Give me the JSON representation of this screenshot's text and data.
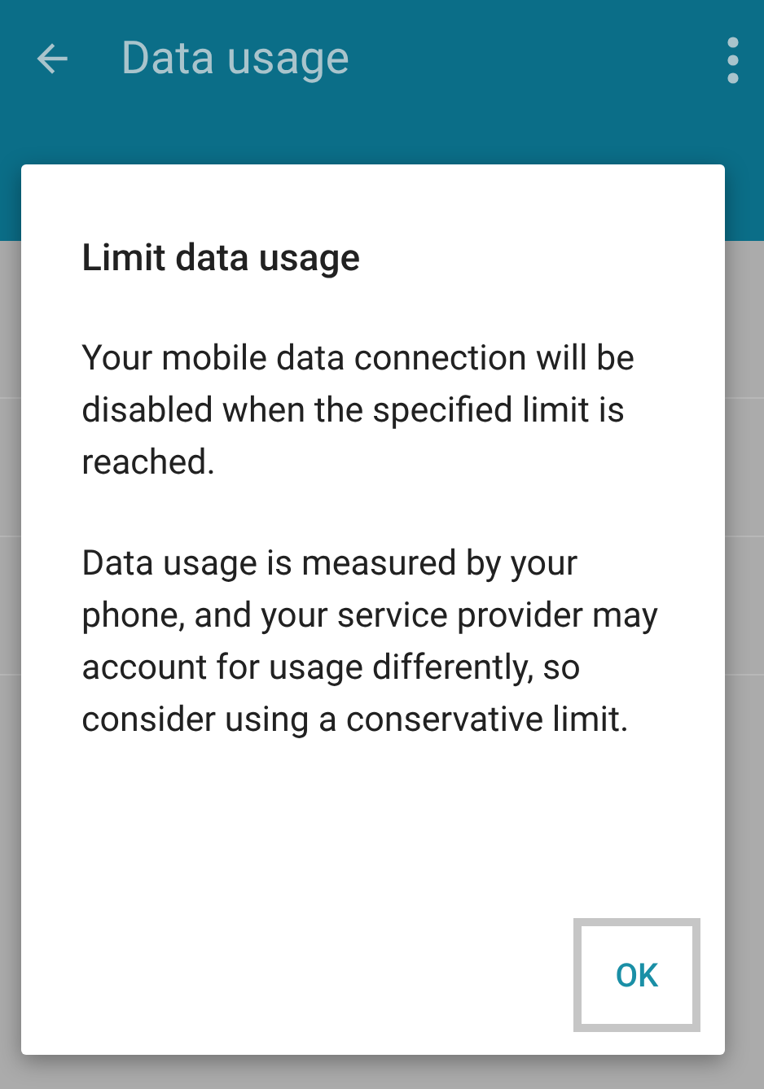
{
  "app_bar": {
    "title": "Data usage"
  },
  "dialog": {
    "title": "Limit data usage",
    "paragraphs": [
      "Your mobile data connection will be disabled when the specified limit is reached.",
      "Data usage is measured by your phone, and your service provider may account for usage differently, so consider using a conservative limit."
    ],
    "buttons": [
      {
        "label": "OK",
        "focused": true
      }
    ]
  }
}
